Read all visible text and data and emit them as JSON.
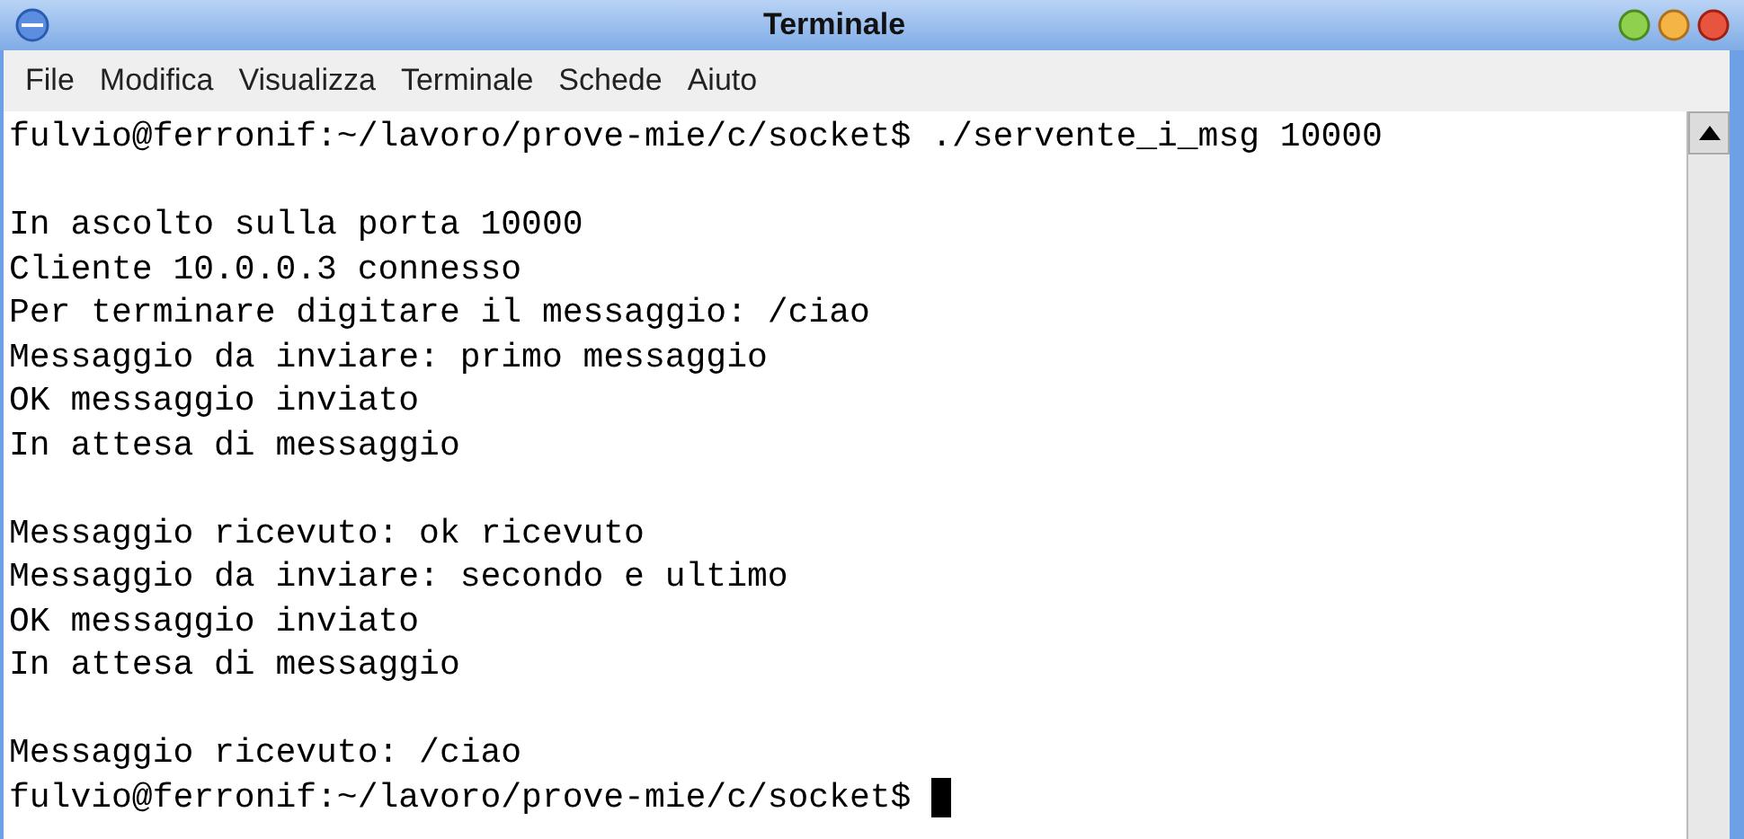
{
  "window": {
    "title": "Terminale"
  },
  "menu": [
    "File",
    "Modifica",
    "Visualizza",
    "Terminale",
    "Schede",
    "Aiuto"
  ],
  "terminal": {
    "lines": [
      {
        "kind": "text",
        "text": "fulvio@ferronif:~/lavoro/prove-mie/c/socket$ ./servente_i_msg 10000"
      },
      {
        "kind": "blank"
      },
      {
        "kind": "text",
        "text": "In ascolto sulla porta 10000"
      },
      {
        "kind": "text",
        "text": "Cliente 10.0.0.3 connesso"
      },
      {
        "kind": "text",
        "text": "Per terminare digitare il messaggio: /ciao"
      },
      {
        "kind": "text",
        "text": "Messaggio da inviare: primo messaggio"
      },
      {
        "kind": "text",
        "text": "OK messaggio inviato"
      },
      {
        "kind": "text",
        "text": "In attesa di messaggio"
      },
      {
        "kind": "blank"
      },
      {
        "kind": "text",
        "text": "Messaggio ricevuto: ok ricevuto"
      },
      {
        "kind": "text",
        "text": "Messaggio da inviare: secondo e ultimo"
      },
      {
        "kind": "text",
        "text": "OK messaggio inviato"
      },
      {
        "kind": "text",
        "text": "In attesa di messaggio"
      },
      {
        "kind": "blank"
      },
      {
        "kind": "text",
        "text": "Messaggio ricevuto: /ciao"
      },
      {
        "kind": "prompt",
        "text": "fulvio@ferronif:~/lavoro/prove-mie/c/socket$ "
      }
    ]
  }
}
